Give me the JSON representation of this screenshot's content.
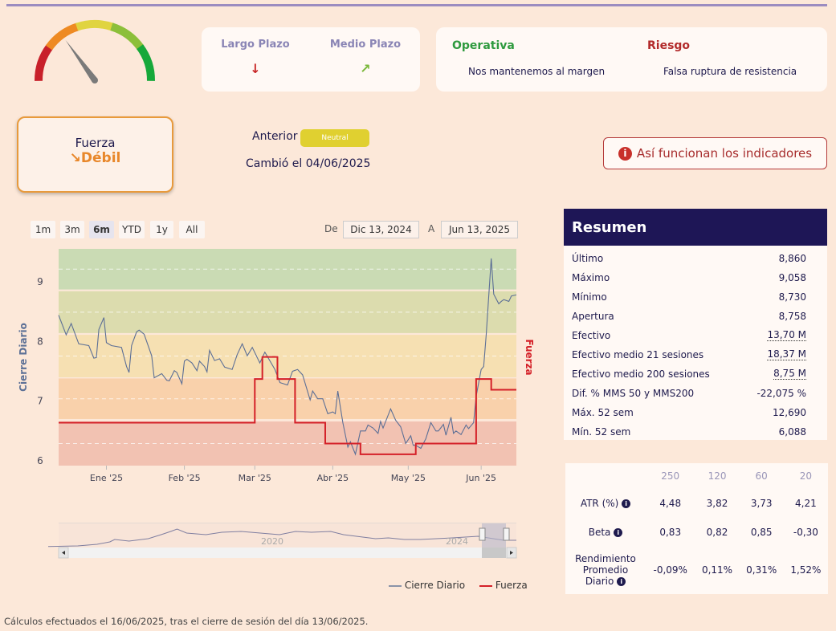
{
  "gauge": {
    "value_fraction": 0.3,
    "segments": [
      "#c8202a",
      "#ee8a22",
      "#e0d440",
      "#8cbf3a",
      "#16a83a"
    ]
  },
  "plazo": {
    "largo": {
      "label": "Largo Plazo",
      "arrow": "↓",
      "color": "#c82828"
    },
    "medio": {
      "label": "Medio Plazo",
      "arrow": "↗",
      "color": "#7ab83a"
    }
  },
  "operativa": {
    "title": "Operativa",
    "text": "Nos mantenemos al margen",
    "color": "#2e9a3e"
  },
  "riesgo": {
    "title": "Riesgo",
    "text": "Falsa ruptura de resistencia",
    "color": "#b22a2a"
  },
  "fuerza": {
    "label": "Fuerza",
    "arrow": "↘",
    "value": "Débil",
    "color": "#e8872a"
  },
  "anterior": {
    "label": "Anterior",
    "badge": "Neutral",
    "changed": "Cambió el 04/06/2025"
  },
  "info_button": {
    "icon": "info-icon",
    "label": "Así funcionan los indicadores"
  },
  "range": {
    "buttons": [
      "1m",
      "3m",
      "6m",
      "YTD",
      "1y",
      "All"
    ],
    "selected": "6m",
    "from_label": "De",
    "from": "Dic 13, 2024",
    "to_label": "A",
    "to": "Jun 13, 2025"
  },
  "chart_data": {
    "type": "line",
    "x_unit": "days since 2024-12-13",
    "ylabel": "Cierre Diario",
    "ylabel_right": "Fuerza",
    "ylim": [
      5.92,
      9.55
    ],
    "yticks": [
      6,
      7,
      8,
      9
    ],
    "xticks": [
      {
        "day": 19,
        "label": "Ene '25"
      },
      {
        "day": 50,
        "label": "Feb '25"
      },
      {
        "day": 78,
        "label": "Mar '25"
      },
      {
        "day": 109,
        "label": "Abr '25"
      },
      {
        "day": 139,
        "label": "May '25"
      },
      {
        "day": 168,
        "label": "Jun '25"
      }
    ],
    "bands": [
      {
        "from": 8.87,
        "to": 9.55,
        "color": "#cadbb4"
      },
      {
        "from": 8.14,
        "to": 8.84,
        "color": "#dcdcae"
      },
      {
        "from": 7.4,
        "to": 8.11,
        "color": "#f6e0b2"
      },
      {
        "from": 6.7,
        "to": 7.38,
        "color": "#f9d1ab"
      },
      {
        "from": 5.92,
        "to": 6.66,
        "color": "#f2c2b2"
      }
    ],
    "series": [
      {
        "name": "Cierre Diario",
        "color": "#5c6f96",
        "points": [
          [
            0,
            8.44
          ],
          [
            3,
            8.11
          ],
          [
            5,
            8.3
          ],
          [
            8,
            7.96
          ],
          [
            12,
            7.93
          ],
          [
            14,
            7.72
          ],
          [
            15,
            7.73
          ],
          [
            16,
            8.2
          ],
          [
            18,
            8.4
          ],
          [
            19,
            7.98
          ],
          [
            21,
            7.93
          ],
          [
            25,
            7.9
          ],
          [
            27,
            7.58
          ],
          [
            28,
            7.48
          ],
          [
            29,
            7.93
          ],
          [
            31,
            8.16
          ],
          [
            32,
            8.19
          ],
          [
            34,
            8.12
          ],
          [
            37,
            7.76
          ],
          [
            38,
            7.39
          ],
          [
            41,
            7.46
          ],
          [
            43,
            7.35
          ],
          [
            44,
            7.34
          ],
          [
            46,
            7.51
          ],
          [
            47,
            7.48
          ],
          [
            49,
            7.29
          ],
          [
            50,
            7.67
          ],
          [
            51,
            7.7
          ],
          [
            53,
            7.64
          ],
          [
            55,
            7.51
          ],
          [
            56,
            7.67
          ],
          [
            58,
            7.58
          ],
          [
            59,
            7.49
          ],
          [
            60,
            7.85
          ],
          [
            62,
            7.68
          ],
          [
            64,
            7.71
          ],
          [
            66,
            7.57
          ],
          [
            69,
            7.53
          ],
          [
            71,
            7.78
          ],
          [
            73,
            7.96
          ],
          [
            75,
            7.76
          ],
          [
            77,
            7.9
          ],
          [
            80,
            7.64
          ],
          [
            82,
            7.82
          ],
          [
            86,
            7.53
          ],
          [
            88,
            7.31
          ],
          [
            91,
            7.27
          ],
          [
            93,
            7.5
          ],
          [
            95,
            7.53
          ],
          [
            97,
            7.44
          ],
          [
            100,
            7.02
          ],
          [
            101,
            7.17
          ],
          [
            103,
            7.04
          ],
          [
            105,
            7.04
          ],
          [
            107,
            6.79
          ],
          [
            109,
            6.82
          ],
          [
            110,
            6.79
          ],
          [
            111,
            7.17
          ],
          [
            113,
            6.64
          ],
          [
            115,
            6.23
          ],
          [
            116,
            6.32
          ],
          [
            118,
            6.11
          ],
          [
            120,
            6.5
          ],
          [
            122,
            6.5
          ],
          [
            123,
            6.6
          ],
          [
            125,
            6.55
          ],
          [
            127,
            6.46
          ],
          [
            128,
            6.66
          ],
          [
            129,
            6.55
          ],
          [
            132,
            6.87
          ],
          [
            134,
            6.68
          ],
          [
            136,
            6.57
          ],
          [
            138,
            6.29
          ],
          [
            140,
            6.42
          ],
          [
            141,
            6.26
          ],
          [
            142,
            6.26
          ],
          [
            144,
            6.21
          ],
          [
            146,
            6.37
          ],
          [
            148,
            6.64
          ],
          [
            150,
            6.5
          ],
          [
            151,
            6.5
          ],
          [
            153,
            6.61
          ],
          [
            154,
            6.43
          ],
          [
            156,
            6.73
          ],
          [
            157,
            6.46
          ],
          [
            158,
            6.5
          ],
          [
            160,
            6.44
          ],
          [
            162,
            6.6
          ],
          [
            163,
            6.54
          ],
          [
            165,
            6.64
          ],
          [
            166,
            7.08
          ],
          [
            168,
            7.53
          ],
          [
            169,
            7.58
          ],
          [
            170,
            8.11
          ],
          [
            172,
            9.39
          ],
          [
            173,
            8.79
          ],
          [
            175,
            8.63
          ],
          [
            176,
            8.67
          ],
          [
            177,
            8.7
          ],
          [
            179,
            8.67
          ],
          [
            180,
            8.76
          ],
          [
            182,
            8.78
          ]
        ]
      },
      {
        "name": "Fuerza",
        "color": "#d42028",
        "step": true,
        "points": [
          [
            0,
            6.64
          ],
          [
            78,
            7.37
          ],
          [
            81,
            7.74
          ],
          [
            87,
            7.37
          ],
          [
            94,
            6.64
          ],
          [
            106,
            6.29
          ],
          [
            120,
            6.11
          ],
          [
            142,
            6.29
          ],
          [
            166,
            7.37
          ],
          [
            172,
            7.19
          ],
          [
            182,
            7.19
          ]
        ]
      }
    ],
    "navigator": {
      "labels": [
        "2020",
        "2024"
      ]
    },
    "legend": {
      "position": "bottom-right",
      "items": [
        {
          "name": "Cierre Diario",
          "color": "#8a93a8"
        },
        {
          "name": "Fuerza",
          "color": "#d42028"
        }
      ]
    }
  },
  "resumen": {
    "title": "Resumen",
    "rows": [
      {
        "label": "Último",
        "value": "8,860"
      },
      {
        "label": "Máximo",
        "value": "9,058"
      },
      {
        "label": "Mínimo",
        "value": "8,730"
      },
      {
        "label": "Apertura",
        "value": "8,758"
      },
      {
        "label": "Efectivo",
        "value": "13,70 M",
        "dotted": true
      },
      {
        "label": "Efectivo medio 21 sesiones",
        "value": "18,37 M",
        "dotted": true
      },
      {
        "label": "Efectivo medio 200 sesiones",
        "value": "8,75 M",
        "dotted": true
      },
      {
        "label": "Dif. % MMS 50 y MMS200",
        "value": "-22,075 %"
      },
      {
        "label": "Máx. 52 sem",
        "value": "12,690"
      },
      {
        "label": "Mín. 52 sem",
        "value": "6,088"
      }
    ]
  },
  "stats": {
    "headers": [
      "250",
      "120",
      "60",
      "20"
    ],
    "rows": [
      {
        "label": "ATR (%)",
        "values": [
          "4,48",
          "3,82",
          "3,73",
          "4,21"
        ]
      },
      {
        "label": "Beta",
        "values": [
          "0,83",
          "0,82",
          "0,85",
          "-0,30"
        ]
      },
      {
        "label": "Rendimiento Promedio Diario",
        "values": [
          "-0,09%",
          "0,11%",
          "0,31%",
          "1,52%"
        ]
      }
    ]
  },
  "footer": "Cálculos efectuados el 16/06/2025, tras el cierre de sesión del día 13/06/2025."
}
